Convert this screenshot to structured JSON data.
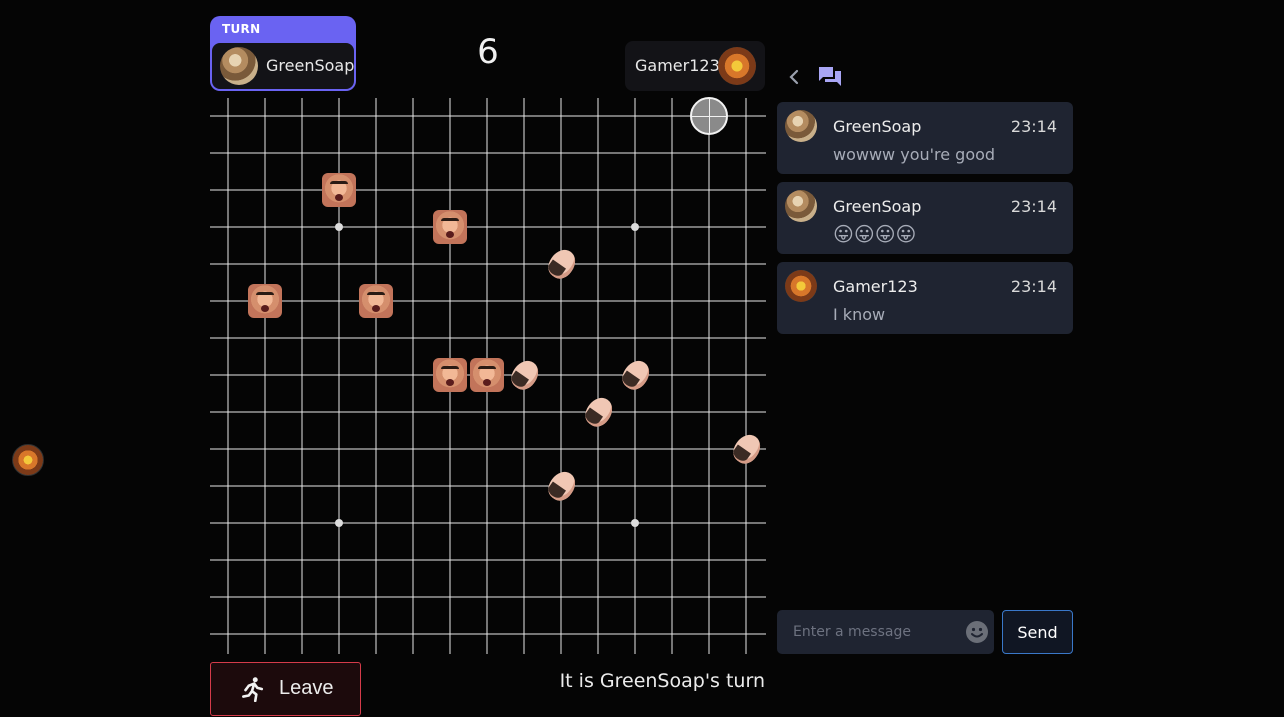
{
  "game": {
    "turn_label": "TURN",
    "current_player": {
      "name": "GreenSoap",
      "avatar_icon": "green-soap-avatar"
    },
    "opponent": {
      "name": "Gamer123",
      "avatar_icon": "gamer123-avatar"
    },
    "move_counter": "6",
    "status": "It is GreenSoap's turn",
    "leave_label": "Leave",
    "board": {
      "lines": 15,
      "star_points": [
        [
          3,
          3
        ],
        [
          11,
          3
        ],
        [
          3,
          11
        ],
        [
          11,
          11
        ]
      ],
      "hover": [
        13,
        0
      ],
      "stones": [
        {
          "col": 3,
          "row": 2,
          "player": "Gamer123"
        },
        {
          "col": 6,
          "row": 3,
          "player": "Gamer123"
        },
        {
          "col": 1,
          "row": 5,
          "player": "Gamer123"
        },
        {
          "col": 4,
          "row": 5,
          "player": "Gamer123"
        },
        {
          "col": 6,
          "row": 7,
          "player": "Gamer123"
        },
        {
          "col": 7,
          "row": 7,
          "player": "Gamer123"
        },
        {
          "col": 9,
          "row": 4,
          "player": "GreenSoap"
        },
        {
          "col": 8,
          "row": 7,
          "player": "GreenSoap"
        },
        {
          "col": 11,
          "row": 7,
          "player": "GreenSoap"
        },
        {
          "col": 10,
          "row": 8,
          "player": "GreenSoap"
        },
        {
          "col": 14,
          "row": 9,
          "player": "GreenSoap"
        },
        {
          "col": 9,
          "row": 10,
          "player": "GreenSoap"
        }
      ]
    }
  },
  "chat": {
    "messages": [
      {
        "user": "GreenSoap",
        "time": "23:14",
        "text": "wowww you're good",
        "avatar_icon": "green-soap-avatar"
      },
      {
        "user": "GreenSoap",
        "time": "23:14",
        "text": "😛😛😛😛",
        "avatar_icon": "green-soap-avatar"
      },
      {
        "user": "Gamer123",
        "time": "23:14",
        "text": "I know",
        "avatar_icon": "gamer123-avatar"
      }
    ],
    "input_placeholder": "Enter a message",
    "send_label": "Send"
  },
  "colors": {
    "turn_accent": "#6a63f2",
    "leave_border": "#d43b4a",
    "send_border": "#3a78c9",
    "chat_bubble": "#1f2431"
  }
}
